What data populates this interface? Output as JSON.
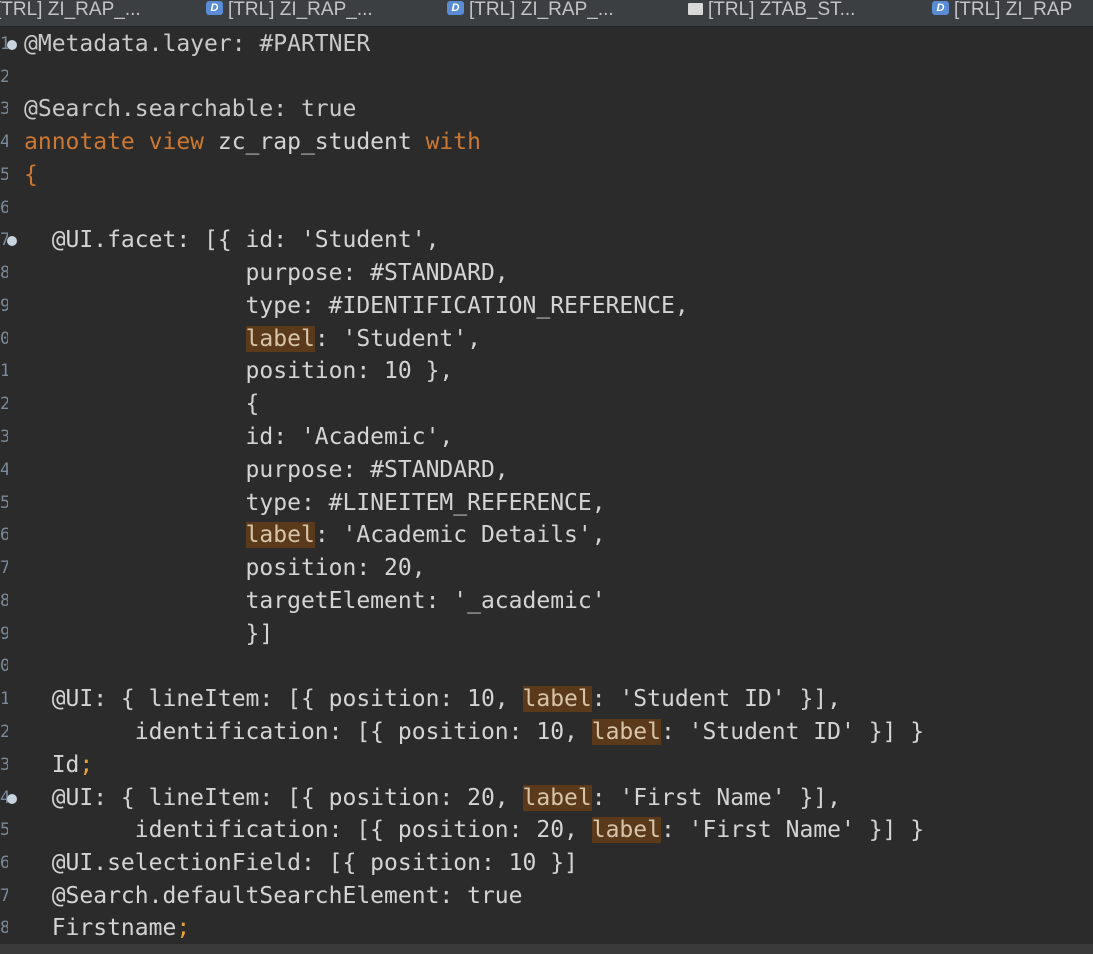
{
  "tabs": [
    {
      "label": "[TRL] ZI_RAP_...",
      "icon": "ddl-icon"
    },
    {
      "label": "[TRL] ZI_RAP_...",
      "icon": "ddl-icon"
    },
    {
      "label": "[TRL] ZI_RAP_...",
      "icon": "ddl-icon"
    },
    {
      "label": "[TRL] ZTAB_ST...",
      "icon": "table-icon"
    },
    {
      "label": "[TRL] ZI_RAP",
      "icon": "ddl-icon"
    }
  ],
  "gutter_numbers": [
    "1",
    "2",
    "3",
    "4",
    "5",
    "6",
    "7",
    "8",
    "9",
    "0",
    "1",
    "2",
    "3",
    "4",
    "5",
    "6",
    "7",
    "8",
    "9",
    "0",
    "1",
    "2",
    "3",
    "4",
    "5",
    "6",
    "7",
    "8"
  ],
  "code": {
    "l1_a": "@Metadata.layer: #PARTNER",
    "l3_a": "@Search.searchable: true",
    "l4_kw1": "annotate view",
    "l4_name": " zc_rap_student ",
    "l4_kw2": "with",
    "l5_brace": "{",
    "l7_a": "  @UI.facet: [{ id: 'Student',",
    "l8_a": "                purpose: #STANDARD,",
    "l9_a": "                type: #IDENTIFICATION_REFERENCE,",
    "l10_pre": "                ",
    "label_word": "label",
    "l10_post": ": 'Student',",
    "l11_a": "                position: 10 },",
    "l12_a": "                {",
    "l13_a": "                id: 'Academic',",
    "l14_a": "                purpose: #STANDARD,",
    "l15_a": "                type: #LINEITEM_REFERENCE,",
    "l16_post": ": 'Academic Details',",
    "l17_a": "                position: 20,",
    "l18_a": "                targetElement: '_academic'",
    "l19_a": "                }]",
    "l21_pre": "  @UI: { lineItem: [{ position: 10, ",
    "l21_post": ": 'Student ID' }],",
    "l22_pre": "        identification: [{ position: 10, ",
    "l22_post": ": 'Student ID' }] }",
    "l23_a": "  Id",
    "semi": ";",
    "l24_pre": "  @UI: { lineItem: [{ position: 20, ",
    "l24_post": ": 'First Name' }],",
    "l25_pre": "        identification: [{ position: 20, ",
    "l25_post": ": 'First Name' }] }",
    "l26_a": "  @UI.selectionField: [{ position: 10 }]",
    "l27_a": "  @Search.defaultSearchElement: true",
    "l28_a": "  Firstname"
  }
}
